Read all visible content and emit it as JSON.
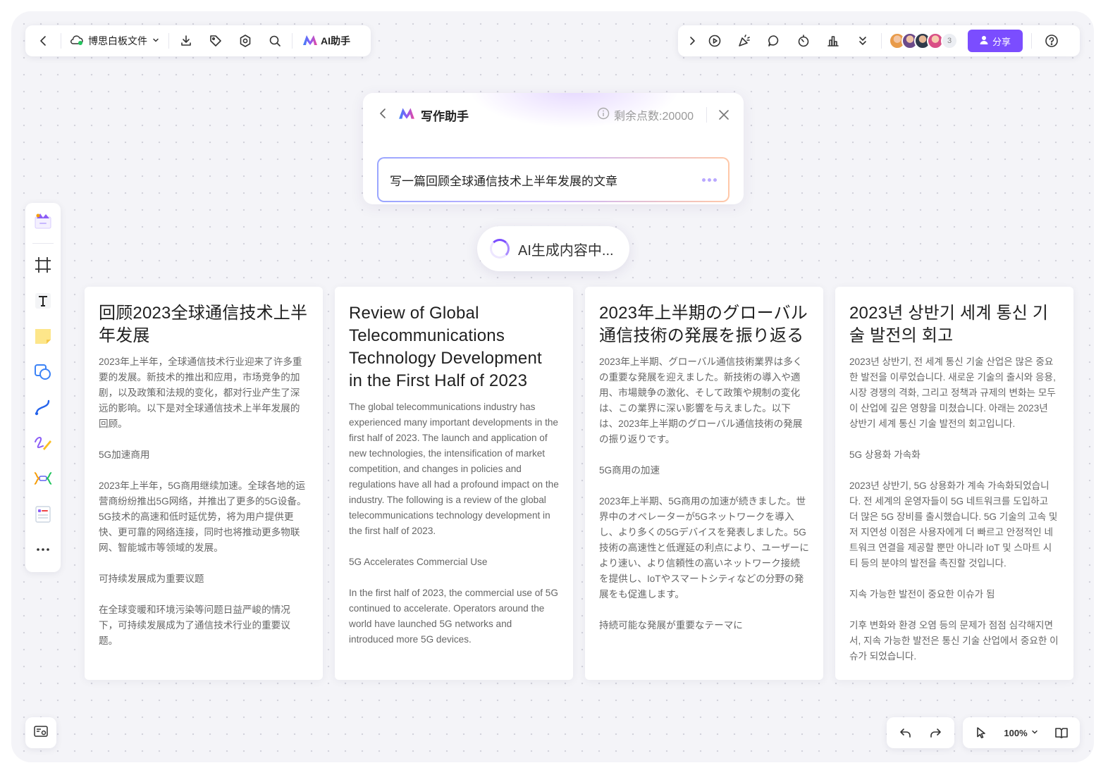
{
  "toolbar_left": {
    "file_name": "博思白板文件",
    "ai_label": "AI助手",
    "icons": [
      "back-icon",
      "cloud-icon",
      "chevron-down-icon",
      "download-icon",
      "tag-icon",
      "settings-icon",
      "search-icon",
      "ai-logo-icon"
    ]
  },
  "toolbar_right": {
    "avatar_count": "3",
    "share_label": "分享",
    "icons": [
      "expand-icon",
      "play-icon",
      "celebrate-icon",
      "comment-icon",
      "timer-icon",
      "vote-icon",
      "more-down-icon",
      "help-icon"
    ]
  },
  "assistant": {
    "title": "写作助手",
    "points": "剩余点数:20000",
    "prompt": "写一篇回顾全球通信技术上半年发展的文章"
  },
  "generating": "AI生成内容中...",
  "cards": [
    {
      "title": "回顾2023全球通信技术上半年发展",
      "paras": [
        "2023年上半年，全球通信技术行业迎来了许多重要的发展。新技术的推出和应用，市场竞争的加剧，以及政策和法规的变化，都对行业产生了深远的影响。以下是对全球通信技术上半年发展的回顾。",
        "5G加速商用",
        "2023年上半年，5G商用继续加速。全球各地的运营商纷纷推出5G网络，并推出了更多的5G设备。5G技术的高速和低时延优势，将为用户提供更快、更可靠的网络连接，同时也将推动更多物联网、智能城市等领域的发展。",
        "可持续发展成为重要议题",
        "在全球变暖和环境污染等问题日益严峻的情况下，可持续发展成为了通信技术行业的重要议题。"
      ]
    },
    {
      "title": "Review of Global Telecommunications Technology Development in the First Half of 2023",
      "paras": [
        "The global telecommunications industry has experienced many important developments in the first half of 2023. The launch and application of new technologies, the intensification of market competition, and changes in policies and regulations have all had a profound impact on the industry. The following is a review of the global telecommunications technology development in the first half of 2023.",
        "5G Accelerates Commercial Use",
        "In the first half of 2023, the commercial use of 5G continued to accelerate. Operators around the world have launched 5G networks and introduced more 5G devices."
      ]
    },
    {
      "title": "2023年上半期のグローバル通信技術の発展を振り返る",
      "paras": [
        "2023年上半期、グローバル通信技術業界は多くの重要な発展を迎えました。新技術の導入や適用、市場競争の激化、そして政策や規制の変化は、この業界に深い影響を与えました。以下は、2023年上半期のグローバル通信技術の発展の振り返りです。",
        "5G商用の加速",
        "2023年上半期、5G商用の加速が続きました。世界中のオペレーターが5Gネットワークを導入し、より多くの5Gデバイスを発表しました。5G技術の高速性と低遅延の利点により、ユーザーにより速い、より信頼性の高いネットワーク接続を提供し、IoTやスマートシティなどの分野の発展をも促進します。",
        "持続可能な発展が重要なテーマに"
      ]
    },
    {
      "title": "2023년 상반기 세계 통신 기술 발전의 회고",
      "paras": [
        "2023년 상반기, 전 세계 통신 기술 산업은 많은 중요한 발전을 이루었습니다. 새로운 기술의 출시와 응용, 시장 경쟁의 격화, 그리고 정책과 규제의 변화는 모두 이 산업에 깊은 영향을 미쳤습니다. 아래는 2023년 상반기 세계 통신 기술 발전의 회고입니다.",
        "5G 상용화 가속화",
        "2023년 상반기, 5G 상용화가 계속 가속화되었습니다. 전 세계의 운영자들이 5G 네트워크를 도입하고 더 많은 5G 장비를 출시했습니다. 5G 기술의 고속 및 저 지연성 이점은 사용자에게 더 빠르고 안정적인 네트워크 연결을 제공할 뿐만 아니라 IoT 및 스마트 시티 등의 분야의 발전을 촉진할 것입니다.",
        "지속 가능한 발전이 중요한 이슈가 됨",
        "기후 변화와 환경 오염 등의 문제가 점점 심각해지면서, 지속 가능한 발전은 통신 기술 산업에서 중요한 이슈가 되었습니다."
      ]
    }
  ],
  "sidebar_items": [
    "template-icon",
    "frame-icon",
    "text-icon",
    "sticky-note-icon",
    "shape-icon",
    "connector-icon",
    "pen-icon",
    "mindmap-icon",
    "list-card-icon",
    "more-icon"
  ],
  "zoom": "100%",
  "colors": {
    "accent": "#7b4dff",
    "canvas": "#f4f4f8"
  }
}
